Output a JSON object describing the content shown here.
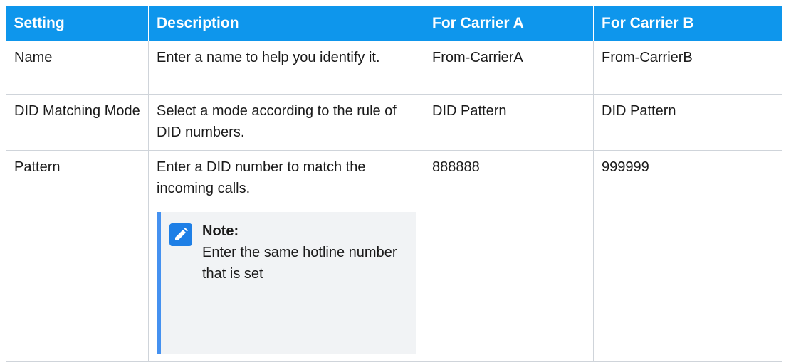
{
  "table": {
    "headers": [
      "Setting",
      "Description",
      "For Carrier A",
      "For Carrier B"
    ],
    "rows": [
      {
        "setting": "Name",
        "description": "Enter a name to help you identify it.",
        "carrier_a": "From-CarrierA",
        "carrier_b": "From-CarrierB"
      },
      {
        "setting": "DID Matching Mode",
        "description": "Select a mode according to the rule of DID numbers.",
        "carrier_a": "DID Pattern",
        "carrier_b": "DID Pattern"
      },
      {
        "setting": "Pattern",
        "description": "Enter a DID number to match the incoming calls.",
        "carrier_a": "888888",
        "carrier_b": "999999",
        "note": {
          "title": "Note:",
          "body": "Enter the same hotline number that is set"
        }
      }
    ]
  },
  "icons": {
    "note": "edit-pencil-icon"
  },
  "colors": {
    "header_bg": "#0e96ec",
    "note_accent": "#4591f0",
    "note_bg": "#f1f3f5"
  }
}
